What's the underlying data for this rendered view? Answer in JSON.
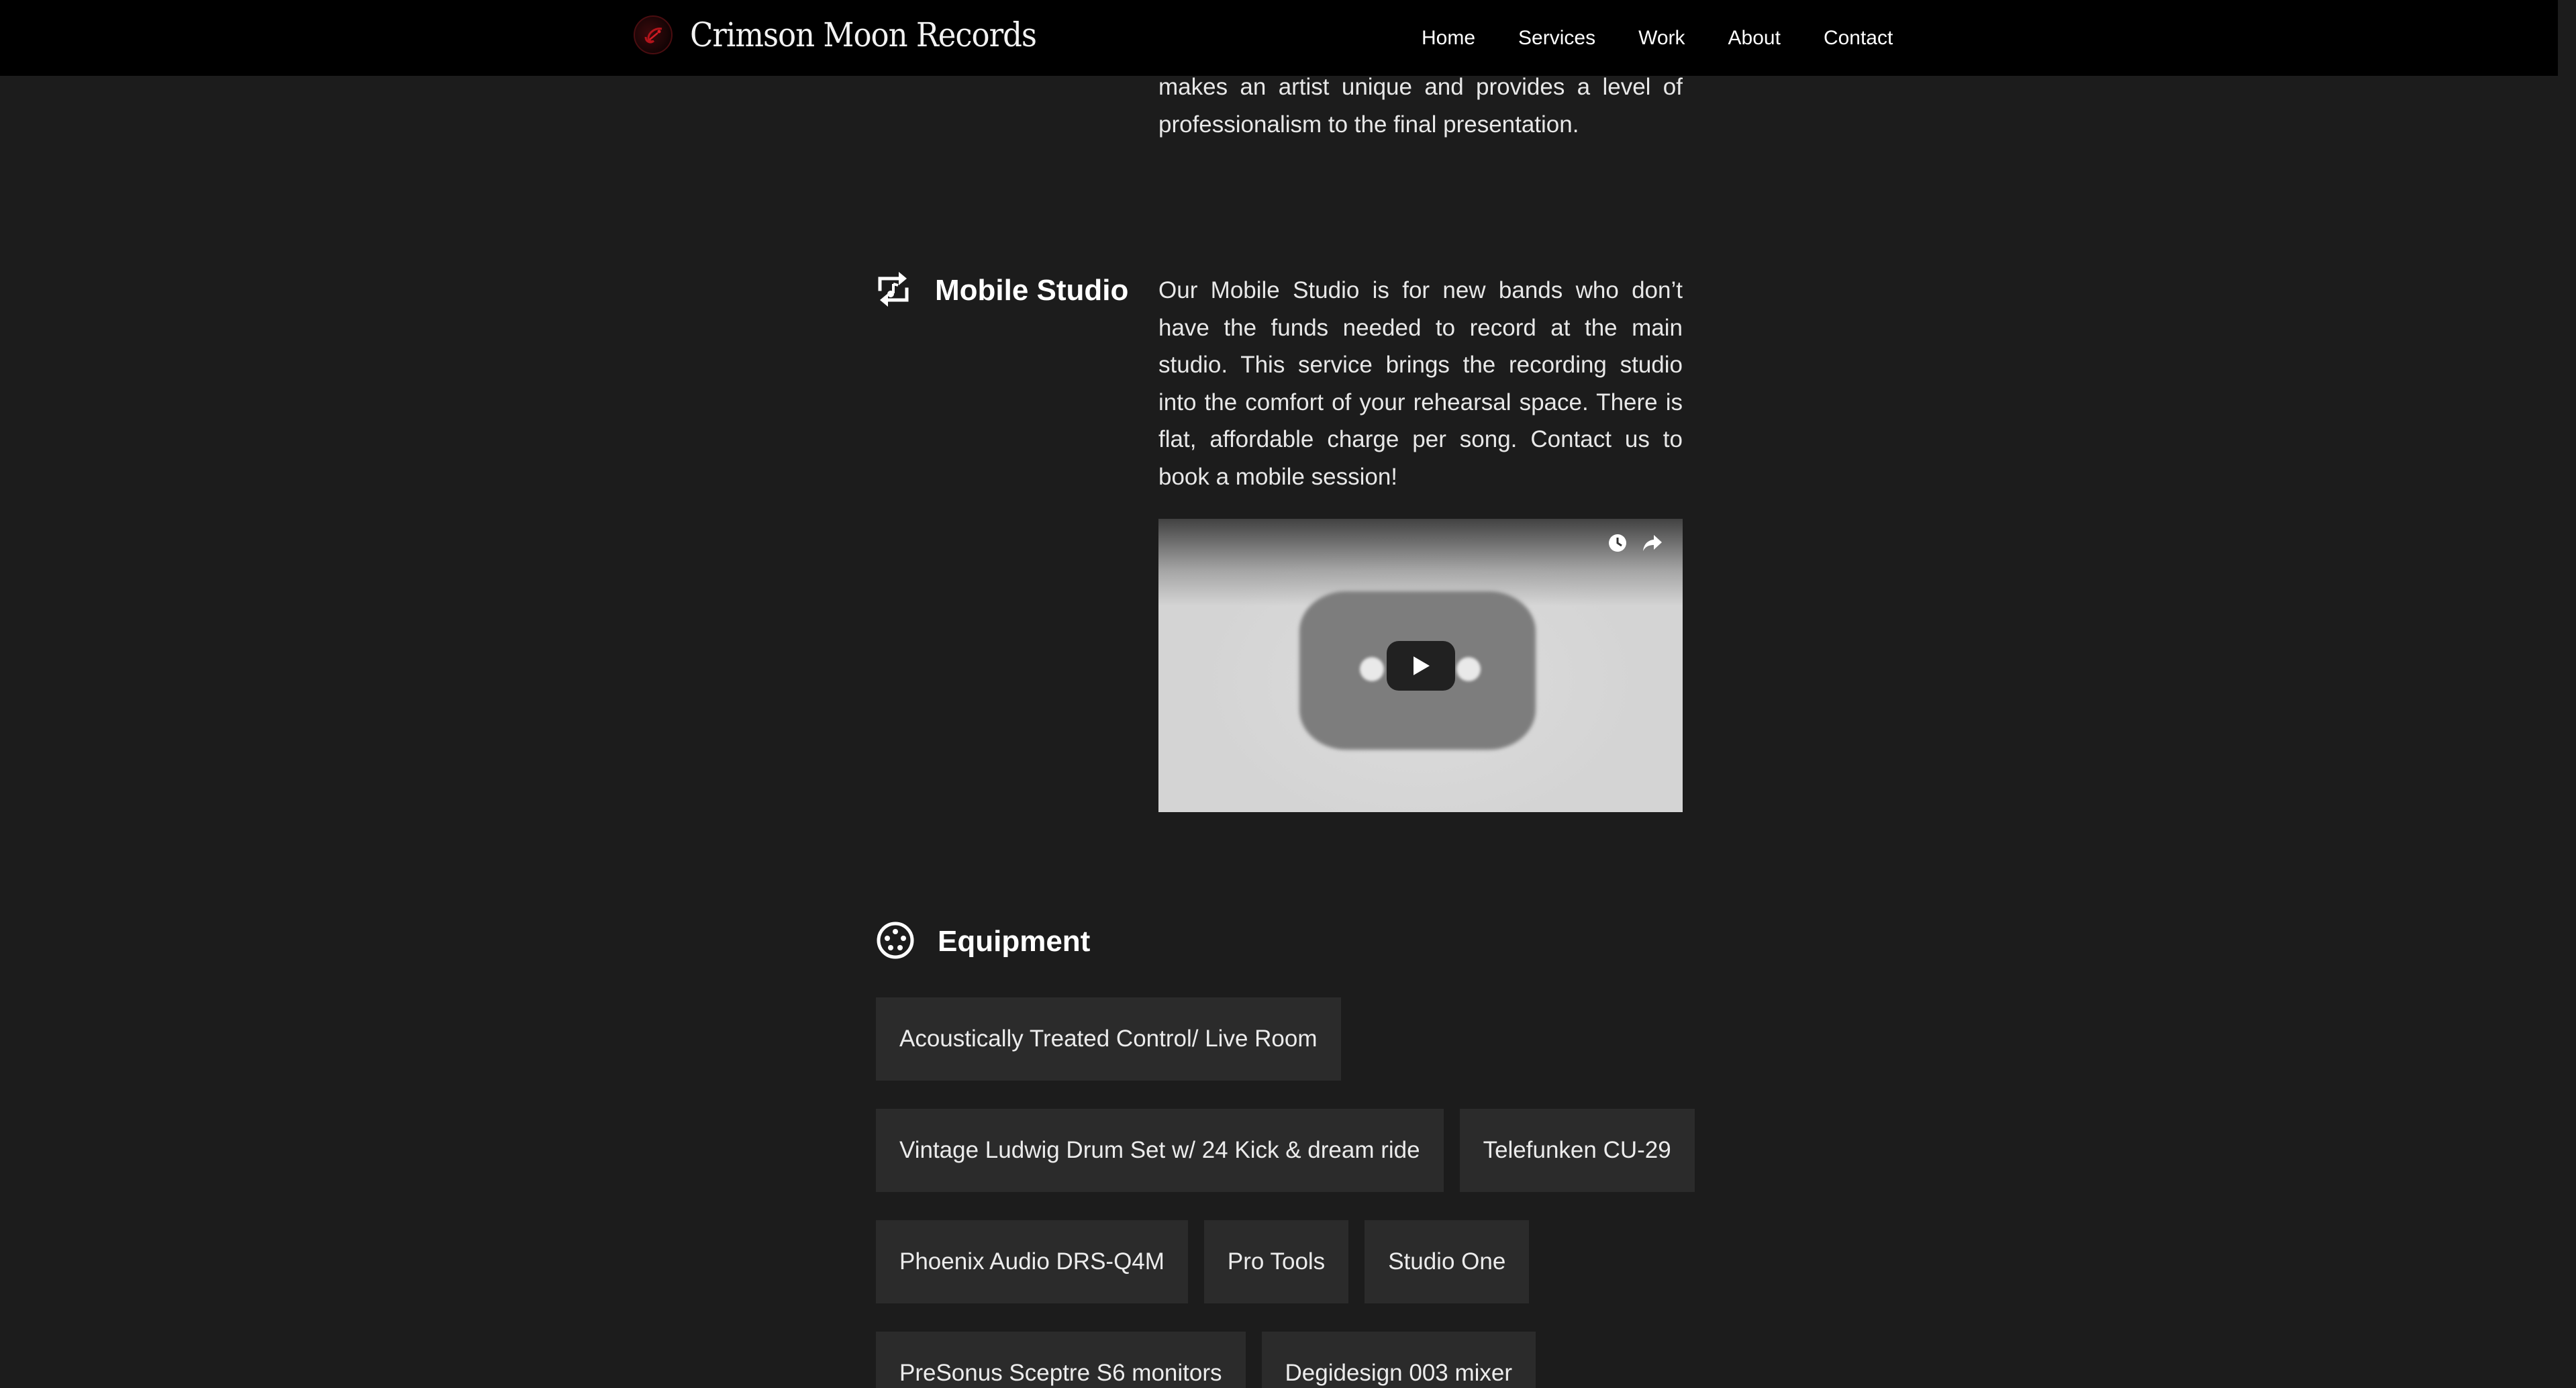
{
  "brand": {
    "name": "Crimson Moon Records",
    "logo_icon": "crimson-moon-logo-icon",
    "accent": "#b3141b"
  },
  "nav": {
    "items": [
      {
        "label": "Home"
      },
      {
        "label": "Services"
      },
      {
        "label": "Work"
      },
      {
        "label": "About"
      },
      {
        "label": "Contact"
      }
    ]
  },
  "intro_tail": {
    "text": "makes an artist unique and provides a level of professionalism to the final presentation."
  },
  "mobile_studio": {
    "icon": "repeat-music-icon",
    "title": "Mobile Studio",
    "text": "Our Mobile Studio is for new bands who don’t have the funds needed to record at the main studio. This service brings the recording studio into the comfort of your rehearsal space. There is flat, affordable charge per song. Contact us to book a mobile session!",
    "video": {
      "play_icon": "play-icon",
      "watch_later_icon": "clock-icon",
      "share_icon": "share-icon"
    }
  },
  "equipment": {
    "icon": "xlr-connector-icon",
    "title": "Equipment",
    "rows": [
      [
        "Acoustically Treated Control/ Live Room"
      ],
      [
        "Vintage Ludwig Drum Set w/ 24 Kick & dream ride",
        "Telefunken CU-29"
      ],
      [
        "Phoenix Audio DRS-Q4M",
        "Pro Tools",
        "Studio One"
      ],
      [
        "PreSonus Sceptre S6 monitors",
        "Degidesign 003 mixer"
      ]
    ]
  },
  "colors": {
    "background": "#1c1c1c",
    "navbar": "#000000",
    "chip": "#2b2b2b",
    "text": "#e8e8e8"
  }
}
